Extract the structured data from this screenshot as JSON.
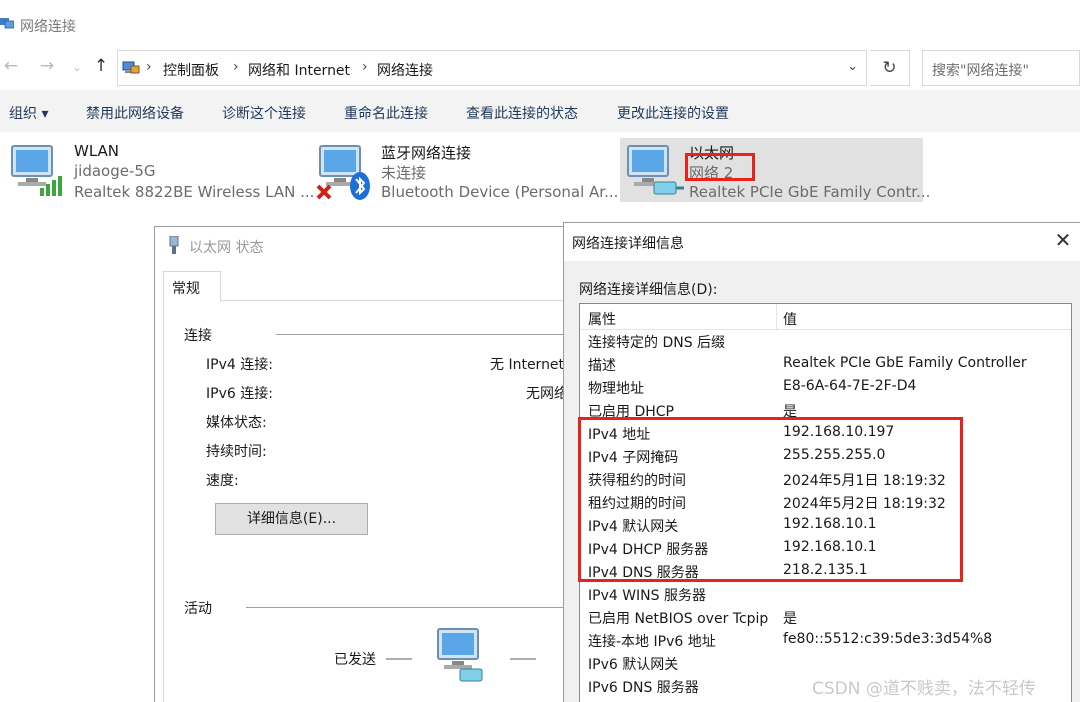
{
  "window": {
    "title": "网络连接"
  },
  "address": {
    "crumbs": [
      "控制面板",
      "网络和 Internet",
      "网络连接"
    ],
    "search_placeholder": "搜索\"网络连接\""
  },
  "toolbar": {
    "organize": "组织 ▾",
    "disable": "禁用此网络设备",
    "diagnose": "诊断这个连接",
    "rename": "重命名此连接",
    "view_status": "查看此连接的状态",
    "change_settings": "更改此连接的设置"
  },
  "connections": [
    {
      "name": "WLAN",
      "status": "jidaoge-5G",
      "device": "Realtek 8822BE Wireless LAN ..."
    },
    {
      "name": "蓝牙网络连接",
      "status": "未连接",
      "device": "Bluetooth Device (Personal Ar..."
    },
    {
      "name": "以太网",
      "status": "网络 2",
      "device": "Realtek PCIe GbE Family Contr..."
    }
  ],
  "status_dialog": {
    "title": "以太网 状态",
    "tab": "常规",
    "connection_group": "连接",
    "ipv4_label": "IPv4 连接:",
    "ipv4_value": "无 Internet",
    "ipv6_label": "IPv6 连接:",
    "ipv6_value": "无网络",
    "media_label": "媒体状态:",
    "duration_label": "持续时间:",
    "speed_label": "速度:",
    "details_button": "详细信息(E)...",
    "activity_group": "活动",
    "sent_label": "已发送"
  },
  "details_dialog": {
    "title": "网络连接详细信息",
    "list_label": "网络连接详细信息(D):",
    "col_property": "属性",
    "col_value": "值",
    "rows": [
      {
        "p": "连接特定的 DNS 后缀",
        "v": ""
      },
      {
        "p": "描述",
        "v": "Realtek PCIe GbE Family Controller"
      },
      {
        "p": "物理地址",
        "v": "E8-6A-64-7E-2F-D4"
      },
      {
        "p": "已启用 DHCP",
        "v": "是"
      },
      {
        "p": "IPv4 地址",
        "v": "192.168.10.197"
      },
      {
        "p": "IPv4 子网掩码",
        "v": "255.255.255.0"
      },
      {
        "p": "获得租约的时间",
        "v": "2024年5月1日 18:19:32"
      },
      {
        "p": "租约过期的时间",
        "v": "2024年5月2日 18:19:32"
      },
      {
        "p": "IPv4 默认网关",
        "v": "192.168.10.1"
      },
      {
        "p": "IPv4 DHCP 服务器",
        "v": "192.168.10.1"
      },
      {
        "p": "IPv4 DNS 服务器",
        "v": "218.2.135.1"
      },
      {
        "p": "IPv4 WINS 服务器",
        "v": ""
      },
      {
        "p": "已启用 NetBIOS over Tcpip",
        "v": "是"
      },
      {
        "p": "连接-本地 IPv6 地址",
        "v": "fe80::5512:c39:5de3:3d54%8"
      },
      {
        "p": "IPv6 默认网关",
        "v": ""
      },
      {
        "p": "IPv6 DNS 服务器",
        "v": ""
      }
    ]
  },
  "watermark": "CSDN @道不贱卖，法不轻传",
  "colors": {
    "highlight": "#e8231b",
    "toolbar_text": "#1e395b",
    "selected_bg": "#e1e1e1"
  }
}
